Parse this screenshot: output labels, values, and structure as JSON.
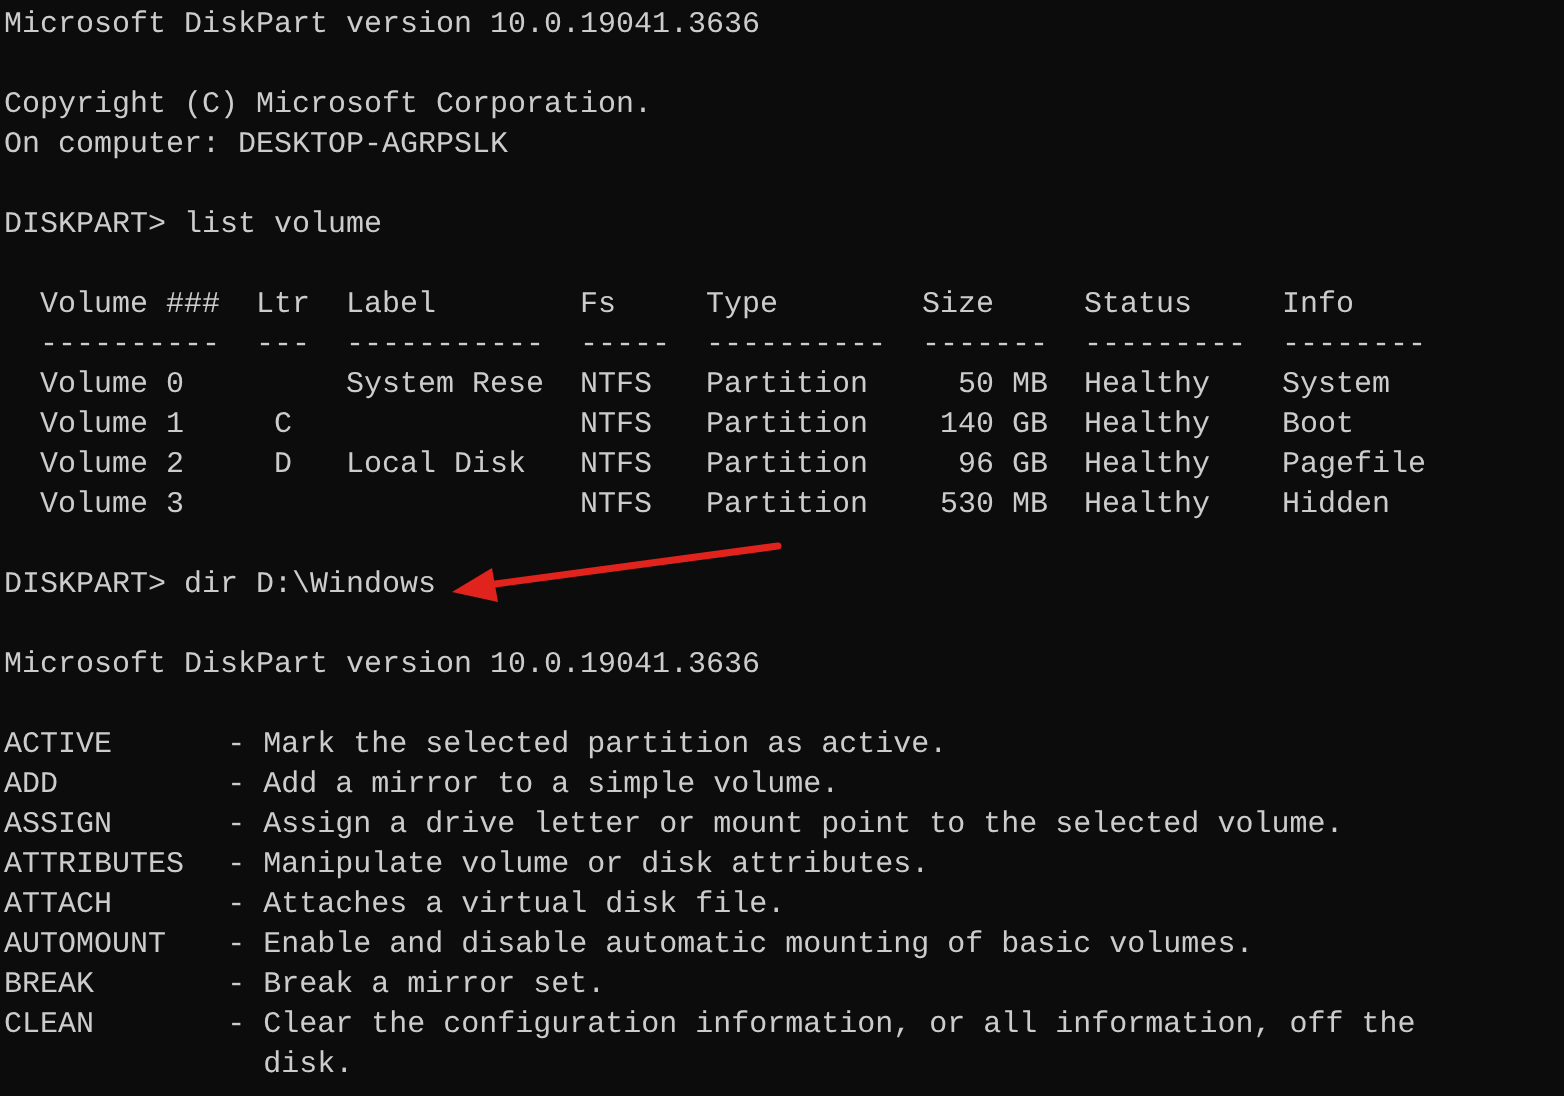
{
  "console": {
    "blocks": [
      {
        "kind": "text",
        "lines": [
          "Microsoft DiskPart version 10.0.19041.3636"
        ]
      },
      {
        "kind": "text",
        "lines": [
          "Copyright (C) Microsoft Corporation.",
          "On computer: DESKTOP-AGRPSLK"
        ]
      },
      {
        "kind": "prompt",
        "text": "DISKPART> list volume",
        "annotated": false
      },
      {
        "kind": "table",
        "columns": [
          {
            "heading": "Volume ###",
            "rule": "----------"
          },
          {
            "heading": "Ltr",
            "rule": "---"
          },
          {
            "heading": "Label",
            "rule": "-----------"
          },
          {
            "heading": "Fs",
            "rule": "-----"
          },
          {
            "heading": "Type",
            "rule": "----------"
          },
          {
            "heading": "Size",
            "rule": "-------"
          },
          {
            "heading": "Status",
            "rule": "---------"
          },
          {
            "heading": "Info",
            "rule": "--------"
          }
        ],
        "rows": [
          [
            "Volume 0",
            "",
            "System Rese",
            "NTFS",
            "Partition",
            "50 MB",
            "Healthy",
            "System"
          ],
          [
            "Volume 1",
            "C",
            "",
            "NTFS",
            "Partition",
            "140 GB",
            "Healthy",
            "Boot"
          ],
          [
            "Volume 2",
            "D",
            "Local Disk",
            "NTFS",
            "Partition",
            "96 GB",
            "Healthy",
            "Pagefile"
          ],
          [
            "Volume 3",
            "",
            "",
            "NTFS",
            "Partition",
            "530 MB",
            "Healthy",
            "Hidden"
          ]
        ]
      },
      {
        "kind": "prompt",
        "text": "DISKPART> dir D:\\Windows",
        "annotated": true
      },
      {
        "kind": "text",
        "lines": [
          "Microsoft DiskPart version 10.0.19041.3636"
        ]
      },
      {
        "kind": "help",
        "entries": [
          {
            "command": "ACTIVE",
            "description": "- Mark the selected partition as active."
          },
          {
            "command": "ADD",
            "description": "- Add a mirror to a simple volume."
          },
          {
            "command": "ASSIGN",
            "description": "- Assign a drive letter or mount point to the selected volume."
          },
          {
            "command": "ATTRIBUTES",
            "description": "- Manipulate volume or disk attributes."
          },
          {
            "command": "ATTACH",
            "description": "- Attaches a virtual disk file."
          },
          {
            "command": "AUTOMOUNT",
            "description": "- Enable and disable automatic mounting of basic volumes."
          },
          {
            "command": "BREAK",
            "description": "- Break a mirror set."
          },
          {
            "command": "CLEAN",
            "description": "- Clear the configuration information, or all information, off the disk."
          }
        ]
      }
    ]
  }
}
